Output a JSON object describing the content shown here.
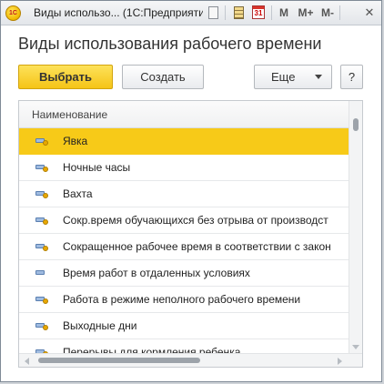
{
  "window": {
    "title": "Виды использо...  (1С:Предприятие)",
    "app_icon_text": "1C",
    "calendar_day": "31",
    "memory_buttons": [
      "M",
      "M+",
      "M-"
    ],
    "close_glyph": "✕"
  },
  "page": {
    "title": "Виды использования рабочего времени"
  },
  "toolbar": {
    "select_label": "Выбрать",
    "create_label": "Создать",
    "more_label": "Еще",
    "help_label": "?"
  },
  "list": {
    "column_header": "Наименование",
    "rows": [
      {
        "label": "Явка",
        "icon": "document-marked-icon",
        "selected": true
      },
      {
        "label": "Ночные часы",
        "icon": "document-marked-icon",
        "selected": false
      },
      {
        "label": "Вахта",
        "icon": "document-marked-icon",
        "selected": false
      },
      {
        "label": "Сокр.время обучающихся без отрыва от производст",
        "icon": "document-marked-icon",
        "selected": false
      },
      {
        "label": "Сокращенное рабочее время в соответствии с закон",
        "icon": "document-marked-icon",
        "selected": false
      },
      {
        "label": "Время работ в отдаленных условиях",
        "icon": "document-icon",
        "selected": false
      },
      {
        "label": "Работа в режиме неполного рабочего времени",
        "icon": "document-marked-icon",
        "selected": false
      },
      {
        "label": "Выходные дни",
        "icon": "document-marked-icon",
        "selected": false
      },
      {
        "label": "Перерывы для кормления ребенка",
        "icon": "document-marked-icon",
        "selected": false
      }
    ]
  },
  "colors": {
    "accent": "#f7ca18",
    "primary_button": "#f5c417"
  }
}
